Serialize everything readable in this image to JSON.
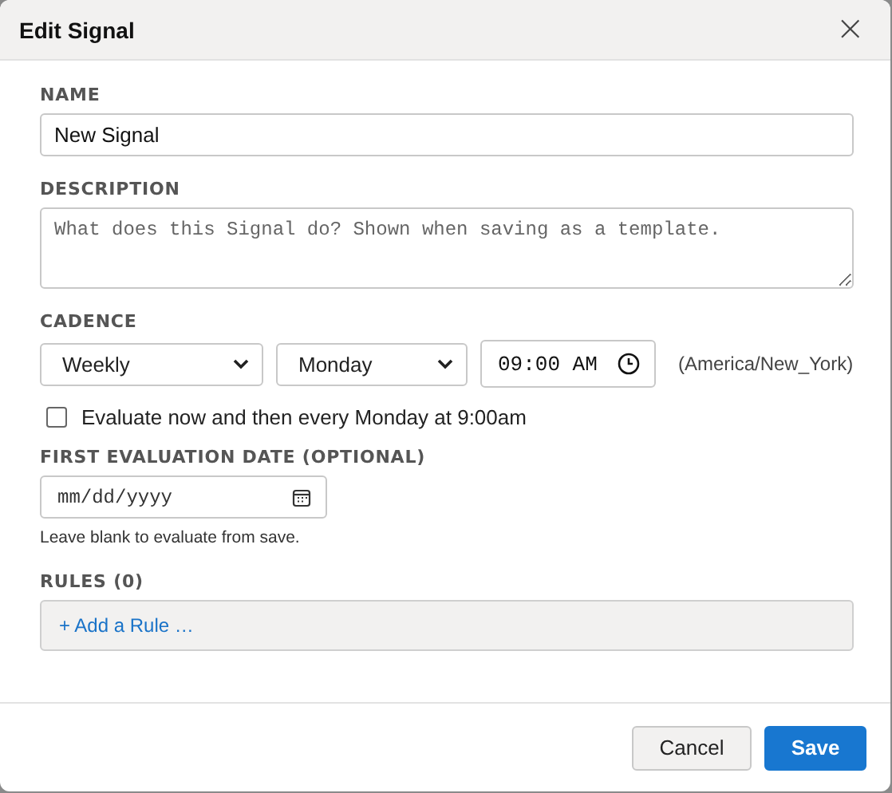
{
  "window": {
    "title": "Edit Signal",
    "close": "×"
  },
  "name": {
    "label": "NAME",
    "value": "New Signal"
  },
  "description": {
    "label": "DESCRIPTION",
    "placeholder": "What does this Signal do? Shown when saving as a template."
  },
  "cadence": {
    "label": "CADENCE",
    "frequency": "Weekly",
    "day": "Monday",
    "time": "09:00 AM",
    "timezone": "(America/New_York)"
  },
  "evaluate_now": {
    "label": "Evaluate now and then every Monday at 9:00am",
    "checked": false
  },
  "first_evaluation": {
    "label": "FIRST EVALUATION DATE (OPTIONAL)",
    "placeholder": "mm/dd/yyyy",
    "hint": "Leave blank to evaluate from save."
  },
  "rules": {
    "label": "RULES (0)",
    "add": "+ Add a Rule …"
  },
  "buttons": [
    {
      "label": "Cancel",
      "kind": "secondary"
    },
    {
      "label": "Save",
      "kind": "primary"
    }
  ]
}
